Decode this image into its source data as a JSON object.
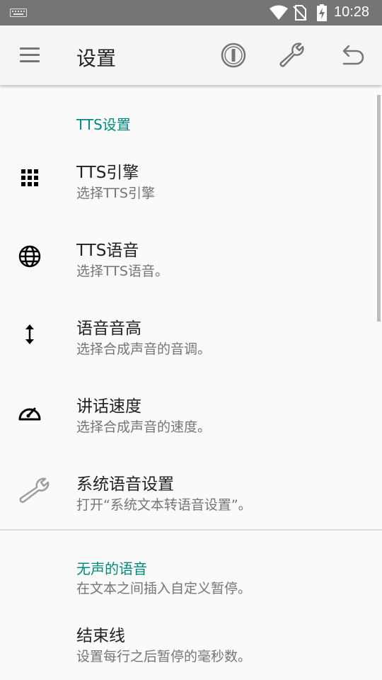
{
  "status_bar": {
    "time": "10:28",
    "icons": [
      "keyboard-icon",
      "wifi-icon",
      "no-sim-icon",
      "battery-charging-icon"
    ]
  },
  "app_bar": {
    "title": "设置",
    "actions": [
      "info-icon",
      "wrench-icon",
      "undo-icon"
    ]
  },
  "sections": [
    {
      "header": "TTS设置",
      "items": [
        {
          "title": "TTS引擎",
          "summary": "选择TTS引擎",
          "icon": "grid-icon"
        },
        {
          "title": "TTS语音",
          "summary": "选择TTS语音。",
          "icon": "globe-icon"
        },
        {
          "title": "语音音高",
          "summary": "选择合成声音的音调。",
          "icon": "vertical-arrows-icon"
        },
        {
          "title": "讲话速度",
          "summary": "选择合成声音的速度。",
          "icon": "speedometer-icon"
        },
        {
          "title": "系统语音设置",
          "summary": "打开“系统文本转语音设置”。",
          "icon": "wrench-icon"
        }
      ]
    },
    {
      "header": "无声的语音",
      "header_summary": "在文本之间插入自定义暂停。",
      "items": [
        {
          "title": "结束线",
          "summary": "设置每行之后暂停的毫秒数。"
        }
      ]
    }
  ],
  "colors": {
    "accent": "#00897b",
    "status_bar": "#757575",
    "app_bar": "#f5f5f5",
    "background": "#fafafa"
  }
}
